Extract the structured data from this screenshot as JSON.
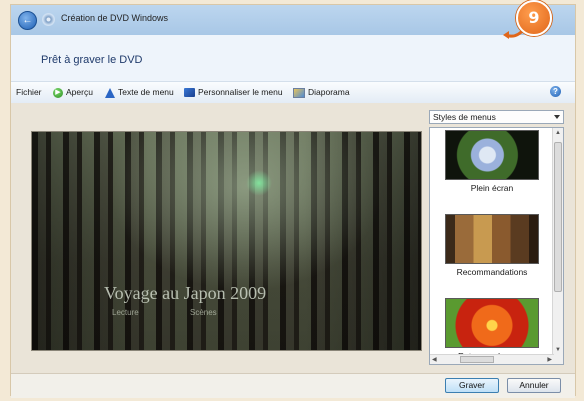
{
  "window": {
    "title": "Création de DVD Windows"
  },
  "step_badge": "9",
  "header": {
    "title": "Prêt à graver le DVD"
  },
  "toolbar": {
    "file": "Fichier",
    "preview": "Aperçu",
    "menu_text": "Texte de menu",
    "customize_menu": "Personnaliser le menu",
    "slideshow": "Diaporama",
    "help": "?"
  },
  "preview": {
    "dvd_title": "Voyage au Japon 2009",
    "options": [
      "Lecture",
      "Scènes"
    ]
  },
  "styles": {
    "selected": "Styles de menus",
    "items": [
      {
        "label": "Plein écran",
        "icon": "hydrangea-thumbnail"
      },
      {
        "label": "Recommandations",
        "icon": "filmstrip-thumbnail"
      },
      {
        "label": "Retourner la page",
        "icon": "flower-thumbnail"
      }
    ]
  },
  "buttons": {
    "burn": "Graver",
    "cancel": "Annuler"
  },
  "colors": {
    "badge": "#e0661a",
    "header_text": "#1f3a6b",
    "titlebar": "#bcd6ef"
  }
}
